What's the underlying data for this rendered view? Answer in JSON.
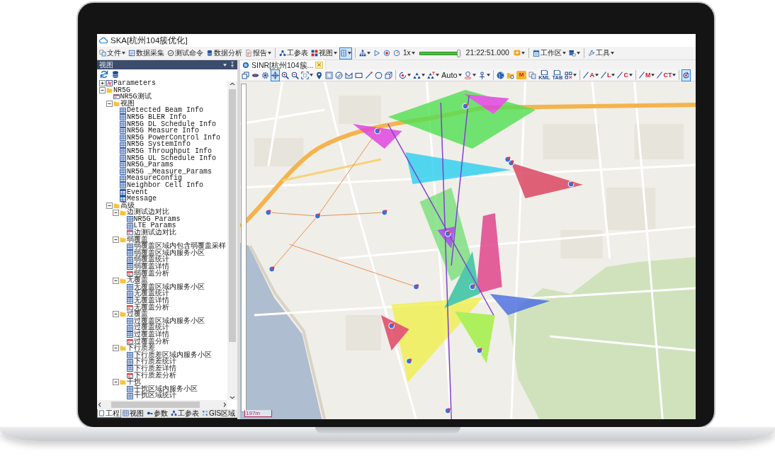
{
  "window": {
    "title": "SKA[杭州104簇优化]"
  },
  "toolbar": [
    {
      "kind": "copy",
      "label": "文件",
      "dropdown": true,
      "pressed": false
    },
    {
      "kind": "form",
      "label": "数据采集",
      "pressed": false
    },
    {
      "kind": "check",
      "label": "测试命令",
      "pressed": false
    },
    {
      "kind": "database",
      "label": "数据分析",
      "pressed": false
    },
    {
      "kind": "report",
      "label": "报告",
      "dropdown": true,
      "pressed": false
    },
    {
      "kind": "separator"
    },
    {
      "kind": "network",
      "label": "工参表",
      "pressed": false
    },
    {
      "kind": "tiles",
      "label": "视图",
      "dropdown": true,
      "pressed": false
    },
    {
      "kind": "sheet",
      "dropdown": true,
      "pressed": true
    },
    {
      "kind": "separator"
    },
    {
      "kind": "hierarchy",
      "dropdown": true,
      "pressed": false
    },
    {
      "kind": "play",
      "pressed": false
    },
    {
      "kind": "record",
      "pressed": false
    },
    {
      "kind": "gauge",
      "pressed": false
    },
    {
      "kind": "text",
      "label": "1x",
      "dropdown": true,
      "pressed": false
    },
    {
      "kind": "slider",
      "level": 0.97
    },
    {
      "kind": "time",
      "label": "21:22:51.000"
    },
    {
      "kind": "badge",
      "dropdown": true,
      "pressed": false
    },
    {
      "kind": "separator"
    },
    {
      "kind": "calendar",
      "label": "工作区",
      "dropdown": true,
      "pressed": false
    },
    {
      "kind": "document",
      "dropdown": true,
      "pressed": false
    },
    {
      "kind": "separator"
    },
    {
      "kind": "wrench",
      "label": "工具",
      "dropdown": true,
      "pressed": false
    }
  ],
  "left_panel": {
    "title": "视图",
    "tools": [
      {
        "kind": "refresh"
      },
      {
        "kind": "database"
      }
    ],
    "tree": [
      {
        "label": "Parameters",
        "kind": "params",
        "expanded": false
      },
      {
        "label": "NR5G",
        "kind": "folder",
        "expanded": true,
        "children": [
          {
            "label": "NR5G测试",
            "kind": "form"
          },
          {
            "label": "视图",
            "kind": "folder",
            "expanded": true,
            "children": [
              {
                "label": "Detected Beam Info",
                "kind": "table"
              },
              {
                "label": "NR5G BLER Info",
                "kind": "table"
              },
              {
                "label": "NR5G DL Schedule Info",
                "kind": "table"
              },
              {
                "label": "NR5G Measure Info",
                "kind": "table"
              },
              {
                "label": "NR5G PowerControl Info",
                "kind": "table"
              },
              {
                "label": "NR5G SystemInfo",
                "kind": "table"
              },
              {
                "label": "NR5G Throughput Info",
                "kind": "table"
              },
              {
                "label": "NR5G UL Schedule Info",
                "kind": "table"
              },
              {
                "label": "NR5G_Params",
                "kind": "table"
              },
              {
                "label": "NR5G _Measure_Params",
                "kind": "table"
              },
              {
                "label": "MeasureConfig",
                "kind": "table"
              },
              {
                "label": "Neighbor Cell Info",
                "kind": "table"
              },
              {
                "label": "Event",
                "kind": "list"
              },
              {
                "label": "Message",
                "kind": "list"
              }
            ]
          },
          {
            "label": "高级",
            "kind": "folder",
            "expanded": true,
            "children": [
              {
                "label": "边测试边对比",
                "kind": "folder",
                "expanded": true,
                "children": [
                  {
                    "label": "NR5G Params",
                    "kind": "table"
                  },
                  {
                    "label": "LTE Params",
                    "kind": "table"
                  },
                  {
                    "label": "边测试边对比",
                    "kind": "form"
                  }
                ]
              },
              {
                "label": "弱覆盖",
                "kind": "folder",
                "expanded": true,
                "children": [
                  {
                    "label": "弱覆盖区域内包含弱覆盖采样",
                    "kind": "table"
                  },
                  {
                    "label": "弱覆盖区域内服务小区",
                    "kind": "table"
                  },
                  {
                    "label": "弱覆盖统计",
                    "kind": "table"
                  },
                  {
                    "label": "弱覆盖详情",
                    "kind": "table"
                  },
                  {
                    "label": "弱覆盖分析",
                    "kind": "form"
                  }
                ]
              },
              {
                "label": "无覆盖",
                "kind": "folder",
                "expanded": true,
                "children": [
                  {
                    "label": "无覆盖区域内服务小区",
                    "kind": "table"
                  },
                  {
                    "label": "无覆盖统计",
                    "kind": "table"
                  },
                  {
                    "label": "无覆盖详情",
                    "kind": "table"
                  },
                  {
                    "label": "无覆盖分析",
                    "kind": "form"
                  }
                ]
              },
              {
                "label": "过覆盖",
                "kind": "folder",
                "expanded": true,
                "children": [
                  {
                    "label": "过覆盖区域内服务小区",
                    "kind": "table"
                  },
                  {
                    "label": "过覆盖统计",
                    "kind": "table"
                  },
                  {
                    "label": "过覆盖详情",
                    "kind": "table"
                  },
                  {
                    "label": "过覆盖分析",
                    "kind": "form"
                  }
                ]
              },
              {
                "label": "下行质差",
                "kind": "folder",
                "expanded": true,
                "children": [
                  {
                    "label": "下行质差区域内服务小区",
                    "kind": "table"
                  },
                  {
                    "label": "下行质差统计",
                    "kind": "table"
                  },
                  {
                    "label": "下行质差详情",
                    "kind": "table"
                  },
                  {
                    "label": "下行质差分析",
                    "kind": "form"
                  }
                ]
              },
              {
                "label": "干扰",
                "kind": "folder",
                "expanded": true,
                "children": [
                  {
                    "label": "干扰区域内服务小区",
                    "kind": "table"
                  },
                  {
                    "label": "干扰区域统计",
                    "kind": "table"
                  }
                ]
              }
            ]
          }
        ]
      }
    ],
    "tabs": [
      {
        "kind": "project",
        "label": "工程",
        "selected": true
      },
      {
        "kind": "grid",
        "label": "视图",
        "selected": false
      },
      {
        "kind": "key",
        "label": "参数",
        "selected": false
      },
      {
        "kind": "network",
        "label": "工参表",
        "selected": false
      },
      {
        "kind": "gis",
        "label": "GIS区域",
        "selected": false
      }
    ]
  },
  "document_tab": {
    "label": "SINR[杭州104簇..."
  },
  "map_toolbar": [
    {
      "kind": "layers",
      "pressed": false
    },
    {
      "kind": "eye",
      "pressed": false
    },
    {
      "kind": "gear",
      "pressed": false
    },
    {
      "kind": "move",
      "pressed": true
    },
    {
      "kind": "zoomin",
      "pressed": false
    },
    {
      "kind": "zoomout",
      "pressed": false
    },
    {
      "kind": "extent",
      "dropdown": true,
      "pressed": false
    },
    {
      "kind": "pin",
      "pressed": false
    },
    {
      "kind": "select",
      "pressed": false
    },
    {
      "kind": "slash",
      "pressed": false
    },
    {
      "kind": "polyline",
      "pressed": false
    },
    {
      "kind": "rect",
      "pressed": false
    },
    {
      "kind": "line",
      "pressed": false
    },
    {
      "kind": "circle",
      "pressed": false
    },
    {
      "kind": "cube",
      "pressed": false
    },
    {
      "kind": "separator"
    },
    {
      "kind": "spin",
      "dropdown": true,
      "pressed": false
    },
    {
      "kind": "nodes",
      "dropdown": true,
      "pressed": false
    },
    {
      "kind": "nodestag",
      "dropdown": true,
      "pressed": false
    },
    {
      "kind": "text",
      "label": "Auto",
      "dropdown": true,
      "pressed": false
    },
    {
      "kind": "location",
      "dropdown": true,
      "pressed": false
    },
    {
      "kind": "antenna",
      "dropdown": true,
      "pressed": false
    },
    {
      "kind": "separator"
    },
    {
      "kind": "globe",
      "pressed": false
    },
    {
      "kind": "foldergear",
      "pressed": false
    },
    {
      "kind": "folder",
      "label": "M",
      "pressed": false
    },
    {
      "kind": "copy",
      "pressed": false
    },
    {
      "kind": "file",
      "label": "KML",
      "pressed": false
    },
    {
      "kind": "file",
      "label": "TAB",
      "pressed": false
    },
    {
      "kind": "gridx",
      "dropdown": true,
      "pressed": false
    },
    {
      "kind": "separator"
    },
    {
      "kind": "pen",
      "label": "A",
      "dropdown": true,
      "pressed": false
    },
    {
      "kind": "pen",
      "label": "L",
      "dropdown": true,
      "pressed": false
    },
    {
      "kind": "pen",
      "label": "C",
      "dropdown": true,
      "pressed": false
    },
    {
      "kind": "separator"
    },
    {
      "kind": "pen",
      "label": "M",
      "dropdown": true,
      "pressed": false
    },
    {
      "kind": "pen",
      "label": "CT",
      "dropdown": true,
      "pressed": false
    },
    {
      "kind": "separator"
    },
    {
      "kind": "cycle",
      "pressed": true
    }
  ],
  "map": {
    "scale": "197m"
  }
}
